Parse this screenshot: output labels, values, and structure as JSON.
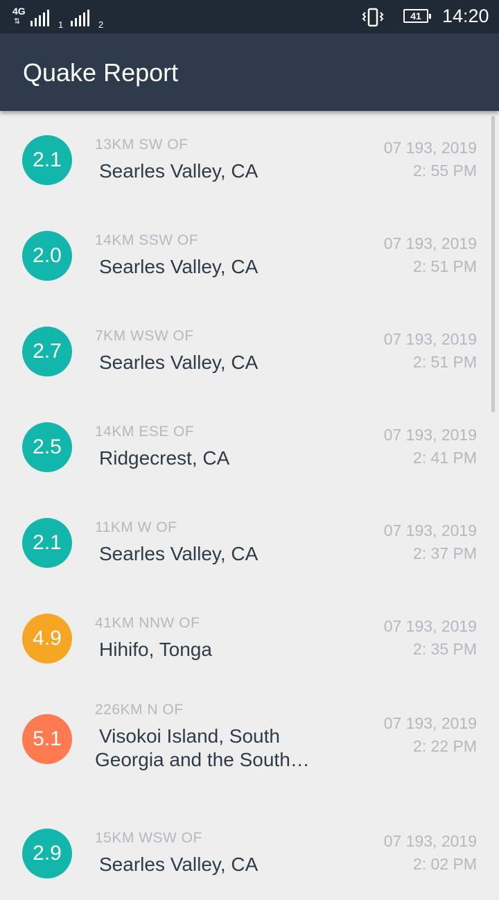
{
  "status_bar": {
    "network": "4G",
    "sim1": "1",
    "sim2": "2",
    "battery": "41",
    "time": "14:20",
    "vibrate_icon": "vibrate-icon"
  },
  "app_bar": {
    "title": "Quake Report"
  },
  "colors": {
    "appbar": "#2c3a4b",
    "statusbar": "#1f2a36",
    "mag_2": "#13b6ab",
    "mag_4": "#f5a623",
    "mag_5": "#ff7a50"
  },
  "earthquakes": [
    {
      "magnitude": "2.1",
      "offset": "13KM SW  OF",
      "location": "Searles Valley, CA",
      "date": "07 193, 2019",
      "time": "2: 55 PM",
      "color": "#13b6ab"
    },
    {
      "magnitude": "2.0",
      "offset": "14KM SSW  OF",
      "location": "Searles Valley, CA",
      "date": "07 193, 2019",
      "time": "2: 51 PM",
      "color": "#13b6ab"
    },
    {
      "magnitude": "2.7",
      "offset": "7KM WSW  OF",
      "location": "Searles Valley, CA",
      "date": "07 193, 2019",
      "time": "2: 51 PM",
      "color": "#13b6ab"
    },
    {
      "magnitude": "2.5",
      "offset": "14KM ESE  OF",
      "location": "Ridgecrest, CA",
      "date": "07 193, 2019",
      "time": "2: 41 PM",
      "color": "#13b6ab"
    },
    {
      "magnitude": "2.1",
      "offset": "11KM W  OF",
      "location": "Searles Valley, CA",
      "date": "07 193, 2019",
      "time": "2: 37 PM",
      "color": "#13b6ab"
    },
    {
      "magnitude": "4.9",
      "offset": "41KM NNW  OF",
      "location": "Hihifo, Tonga",
      "date": "07 193, 2019",
      "time": "2: 35 PM",
      "color": "#f5a623"
    },
    {
      "magnitude": "5.1",
      "offset": "226KM N  OF",
      "location": "Visokoi Island, South Georgia and the South…",
      "date": "07 193, 2019",
      "time": "2: 22 PM",
      "color": "#ff7a50"
    },
    {
      "magnitude": "2.9",
      "offset": "15KM WSW  OF",
      "location": "Searles Valley, CA",
      "date": "07 193, 2019",
      "time": "2: 02 PM",
      "color": "#13b6ab"
    }
  ]
}
